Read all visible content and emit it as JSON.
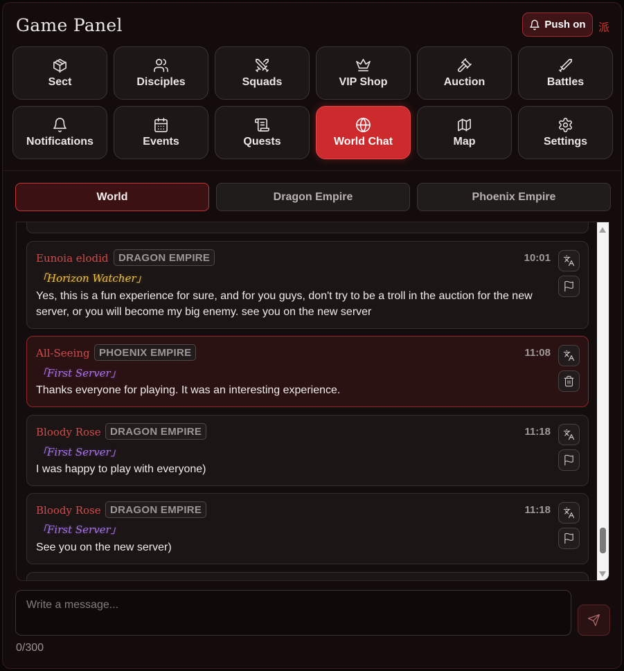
{
  "header": {
    "title": "Game Panel",
    "push_label": "Push on",
    "brand_glyph": "派"
  },
  "nav": [
    {
      "label": "Sect",
      "icon": "cube-icon"
    },
    {
      "label": "Disciples",
      "icon": "users-icon"
    },
    {
      "label": "Squads",
      "icon": "swords-icon"
    },
    {
      "label": "VIP Shop",
      "icon": "crown-icon"
    },
    {
      "label": "Auction",
      "icon": "gavel-icon"
    },
    {
      "label": "Battles",
      "icon": "sword-icon"
    },
    {
      "label": "Notifications",
      "icon": "bell-icon"
    },
    {
      "label": "Events",
      "icon": "calendar-icon"
    },
    {
      "label": "Quests",
      "icon": "scroll-icon"
    },
    {
      "label": "World Chat",
      "icon": "globe-icon",
      "active": true
    },
    {
      "label": "Map",
      "icon": "map-icon"
    },
    {
      "label": "Settings",
      "icon": "gear-icon"
    }
  ],
  "tabs": [
    {
      "label": "World",
      "active": true
    },
    {
      "label": "Dragon Empire"
    },
    {
      "label": "Phoenix Empire"
    }
  ],
  "messages": [
    {
      "name": "Eunoia elodid",
      "faction": "DRAGON EMPIRE",
      "time": "10:01",
      "title_tag": "「Horizon Watcher」",
      "title_color": "gold",
      "text": "Yes, this is a fun experience for sure, and for you guys, don't try to be a troll in the auction for the new server, or you will become my big enemy. see you on the new server",
      "actions": [
        "translate-icon",
        "flag-icon"
      ]
    },
    {
      "name": "All-Seeing",
      "faction": "PHOENIX EMPIRE",
      "time": "11:08",
      "title_tag": "「First Server」",
      "title_color": "purple",
      "text": "Thanks everyone for playing. It was an interesting experience.",
      "actions": [
        "translate-icon",
        "trash-icon"
      ],
      "highlight": true
    },
    {
      "name": "Bloody Rose",
      "faction": "DRAGON EMPIRE",
      "time": "11:18",
      "title_tag": "「First Server」",
      "title_color": "purple",
      "text": "I was happy to play with everyone)",
      "actions": [
        "translate-icon",
        "flag-icon"
      ]
    },
    {
      "name": "Bloody Rose",
      "faction": "DRAGON EMPIRE",
      "time": "11:18",
      "title_tag": "「First Server」",
      "title_color": "purple",
      "text": "See you on the new server)",
      "actions": [
        "translate-icon",
        "flag-icon"
      ]
    }
  ],
  "composer": {
    "placeholder": "Write a message...",
    "value": "",
    "counter": "0/300"
  },
  "colors": {
    "accent": "#cc2a2c",
    "background": "#140c0c",
    "name_red": "#d54a4a",
    "gold_title": "#f1c342",
    "purple_title": "#a775ea"
  }
}
